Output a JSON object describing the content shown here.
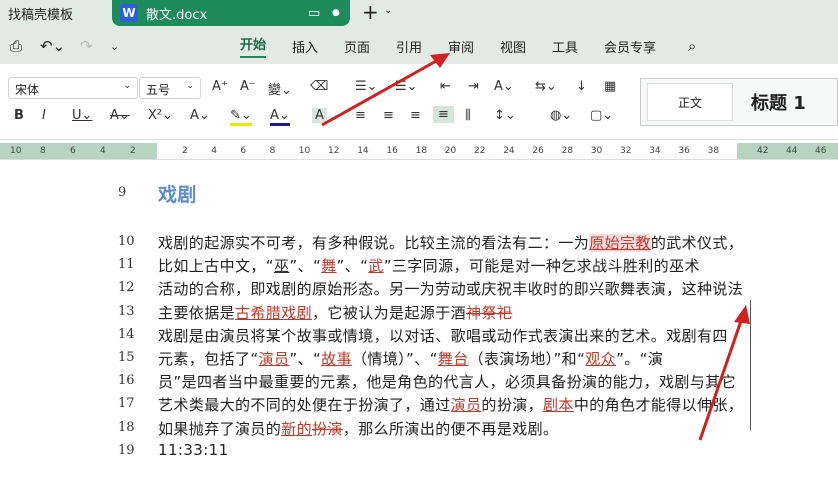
{
  "tabs": [
    {
      "label": "找稿壳模板"
    },
    {
      "label": "散文.docx"
    }
  ],
  "menu": {
    "items": [
      "开始",
      "插入",
      "页面",
      "引用",
      "审阅",
      "视图",
      "工具",
      "会员专享"
    ],
    "active": "开始"
  },
  "ribbon": {
    "font": "宋体",
    "size": "五号",
    "style_normal": "正文",
    "style_h1": "标题 1"
  },
  "ruler": {
    "left": [
      "10",
      "8",
      "6",
      "4",
      "2"
    ],
    "right": [
      "2",
      "4",
      "6",
      "8",
      "10",
      "12",
      "14",
      "16",
      "18",
      "20",
      "22",
      "24",
      "26",
      "28",
      "30",
      "32",
      "34",
      "36",
      "38"
    ],
    "far": [
      "42",
      "44",
      "46"
    ]
  },
  "doc": {
    "lines": [
      {
        "n": "9",
        "segs": [
          {
            "t": "戏剧",
            "c": "h"
          }
        ]
      },
      {
        "n": "10",
        "segs": [
          {
            "t": "戏剧的起源实不可考，有多种假说。比较主流的看法有二：一为"
          },
          {
            "t": "原始宗教",
            "c": "hl"
          },
          {
            "t": "的武术仪式，"
          }
        ]
      },
      {
        "n": "11",
        "segs": [
          {
            "t": "比如上古中文，“"
          },
          {
            "t": "巫",
            "c": "ud"
          },
          {
            "t": "”、“"
          },
          {
            "t": "舞",
            "c": "u"
          },
          {
            "t": "”、“"
          },
          {
            "t": "武",
            "c": "u"
          },
          {
            "t": "”三字同源，可能是对一种乞求战斗胜利的巫术"
          }
        ]
      },
      {
        "n": "12",
        "segs": [
          {
            "t": "活动的合称，即戏剧的原始形态。另一为劳动或庆祝丰收时的即兴歌舞表演，这种说法"
          }
        ]
      },
      {
        "n": "13",
        "segs": [
          {
            "t": "主要依据是"
          },
          {
            "t": "古希腊戏剧",
            "c": "u"
          },
          {
            "t": "，它被认为是起源于酒"
          },
          {
            "t": "神祭祀",
            "c": "s"
          }
        ]
      },
      {
        "n": "14",
        "segs": [
          {
            "t": "戏剧是由演员将某个故事或情境，以对话、歌唱或动作式表演出来的艺术。戏剧有四"
          }
        ]
      },
      {
        "n": "15",
        "segs": [
          {
            "t": "元素，包括了“"
          },
          {
            "t": "演员",
            "c": "u"
          },
          {
            "t": "”、“"
          },
          {
            "t": "故事",
            "c": "u"
          },
          {
            "t": "（情境）”、“"
          },
          {
            "t": "舞台",
            "c": "u"
          },
          {
            "t": "（表演场地）”和“"
          },
          {
            "t": "观众",
            "c": "u"
          },
          {
            "t": "”。“演"
          }
        ]
      },
      {
        "n": "16",
        "segs": [
          {
            "t": "员”是四者当中最重要的元素，他是角色的代言人，必须具备扮演的能力，戏剧与其它"
          }
        ]
      },
      {
        "n": "17",
        "segs": [
          {
            "t": "艺术类最大的不同的处便在于扮演了，通过"
          },
          {
            "t": "演员",
            "c": "u"
          },
          {
            "t": "的扮演，"
          },
          {
            "t": "剧本",
            "c": "u"
          },
          {
            "t": "中的角色才能得以伸张，"
          }
        ]
      },
      {
        "n": "18",
        "segs": [
          {
            "t": "如果抛弃了演员的"
          },
          {
            "t": "新的",
            "c": "u"
          },
          {
            "t": "扮演",
            "c": "s"
          },
          {
            "t": "，那么所演出的便不再是戏剧。"
          }
        ]
      },
      {
        "n": "19",
        "segs": [
          {
            "t": "11:33:11"
          }
        ]
      }
    ]
  },
  "colors": {
    "accent": "#1e8c5a",
    "heading": "#5b8ec9",
    "revision": "#c0392b",
    "arrow": "#d02020"
  }
}
